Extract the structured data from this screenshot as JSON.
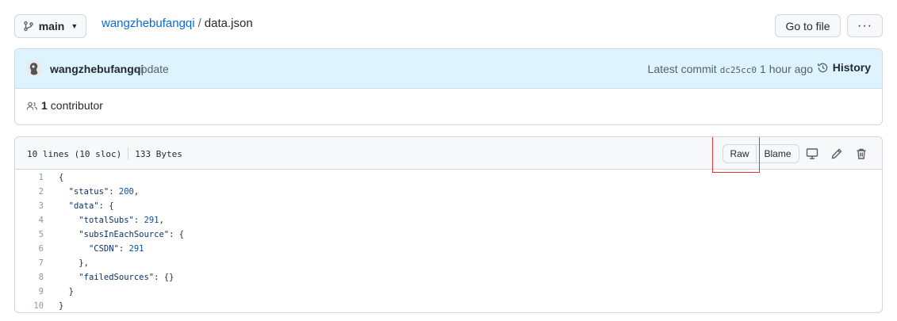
{
  "topbar": {
    "branch": "main",
    "repo": "wangzhebufangqi",
    "separator": "/",
    "file": "data.json",
    "goto_label": "Go to file",
    "more_label": "···"
  },
  "commit": {
    "author": "wangzhebufangqi",
    "message": "update",
    "latest_label": "Latest commit",
    "sha": "dc25cc0",
    "time": "1 hour ago",
    "history_label": "History",
    "contributors_count": "1",
    "contributors_label": "contributor"
  },
  "file_header": {
    "lines_info": "10 lines (10 sloc)",
    "size": "133 Bytes",
    "raw_label": "Raw",
    "blame_label": "Blame"
  },
  "code_lines": [
    {
      "n": "1",
      "text": "{"
    },
    {
      "n": "2",
      "text": "  \"status\": 200,"
    },
    {
      "n": "3",
      "text": "  \"data\": {"
    },
    {
      "n": "4",
      "text": "    \"totalSubs\": 291,"
    },
    {
      "n": "5",
      "text": "    \"subsInEachSource\": {"
    },
    {
      "n": "6",
      "text": "      \"CSDN\": 291"
    },
    {
      "n": "7",
      "text": "    },"
    },
    {
      "n": "8",
      "text": "    \"failedSources\": {}"
    },
    {
      "n": "9",
      "text": "  }"
    },
    {
      "n": "10",
      "text": "}"
    }
  ],
  "colors": {
    "link": "#0969da",
    "commit_bg": "#ddf4ff",
    "highlight": "#d9373a",
    "json_key": "#0a3069",
    "json_number": "#0550ae"
  },
  "icons": [
    "branch-icon",
    "history-icon",
    "people-icon",
    "desktop-icon",
    "pencil-icon",
    "trash-icon"
  ]
}
